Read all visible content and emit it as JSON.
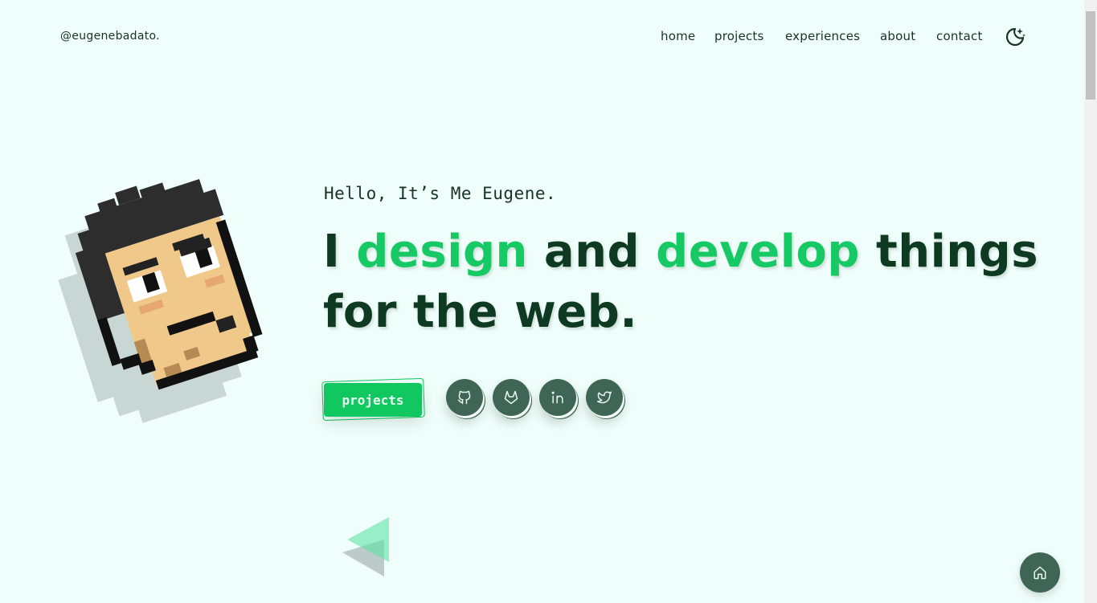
{
  "header": {
    "brand": "@eugenebadato.",
    "nav": [
      "home",
      "projects",
      "experiences",
      "about",
      "contact"
    ],
    "theme_icon": "moon-stars-icon"
  },
  "hero": {
    "greeting": "Hello, It’s Me Eugene.",
    "headline": {
      "w1": "I",
      "w2": "design",
      "w3": "and",
      "w4": "develop",
      "w5": "things",
      "line2": "for the web."
    },
    "cta_label": "projects",
    "socials": [
      "github-icon",
      "gitlab-icon",
      "linkedin-icon",
      "twitter-icon"
    ]
  },
  "fab": {
    "icon": "home-icon"
  },
  "colors": {
    "background": "#effefa",
    "accent": "#17c964",
    "dark_text": "#0e3a21",
    "icon_button": "#3f6655"
  }
}
